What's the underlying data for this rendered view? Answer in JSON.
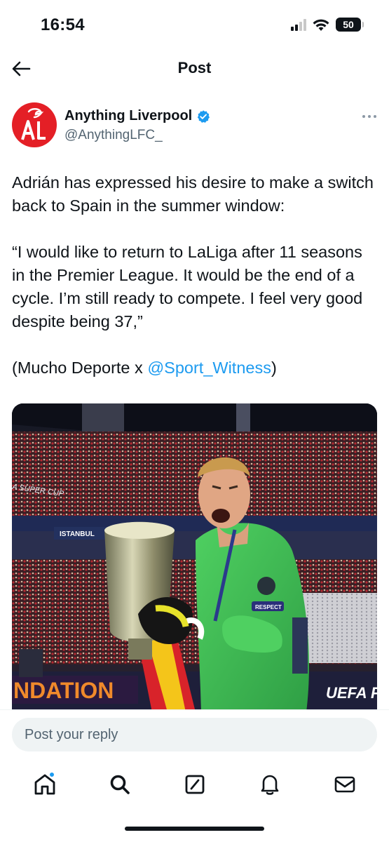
{
  "status_bar": {
    "time": "16:54",
    "battery": "50"
  },
  "header": {
    "title": "Post"
  },
  "author": {
    "name": "Anything Liverpool",
    "handle": "@AnythingLFC_",
    "avatar_text": "AL"
  },
  "post": {
    "paragraph1": "Adrián has expressed his desire to make a switch back to Spain in the summer window:",
    "paragraph2": "“I would like to return to LaLiga after 11 seasons in the Premier League. It would be the end of a cycle. I’m still ready to compete. I feel very good despite being 37,”",
    "paragraph3_prefix": "(Mucho Deporte x ",
    "mention": "@Sport_Witness",
    "paragraph3_suffix": ")"
  },
  "media": {
    "banner_left": "A SUPER CUP",
    "banner_istanbul": "ISTANBUL",
    "banner_foundation": "NDATION",
    "banner_uefa": "UEFA F",
    "banner_respect": "RESPECT"
  },
  "reply": {
    "placeholder": "Post your reply"
  },
  "nav": {
    "items": [
      "home-icon",
      "search-icon",
      "grok-icon",
      "notifications-icon",
      "messages-icon"
    ]
  },
  "colors": {
    "accent": "#1d9bf0",
    "brand_red": "#e41f26",
    "keeper_green": "#43c257"
  }
}
